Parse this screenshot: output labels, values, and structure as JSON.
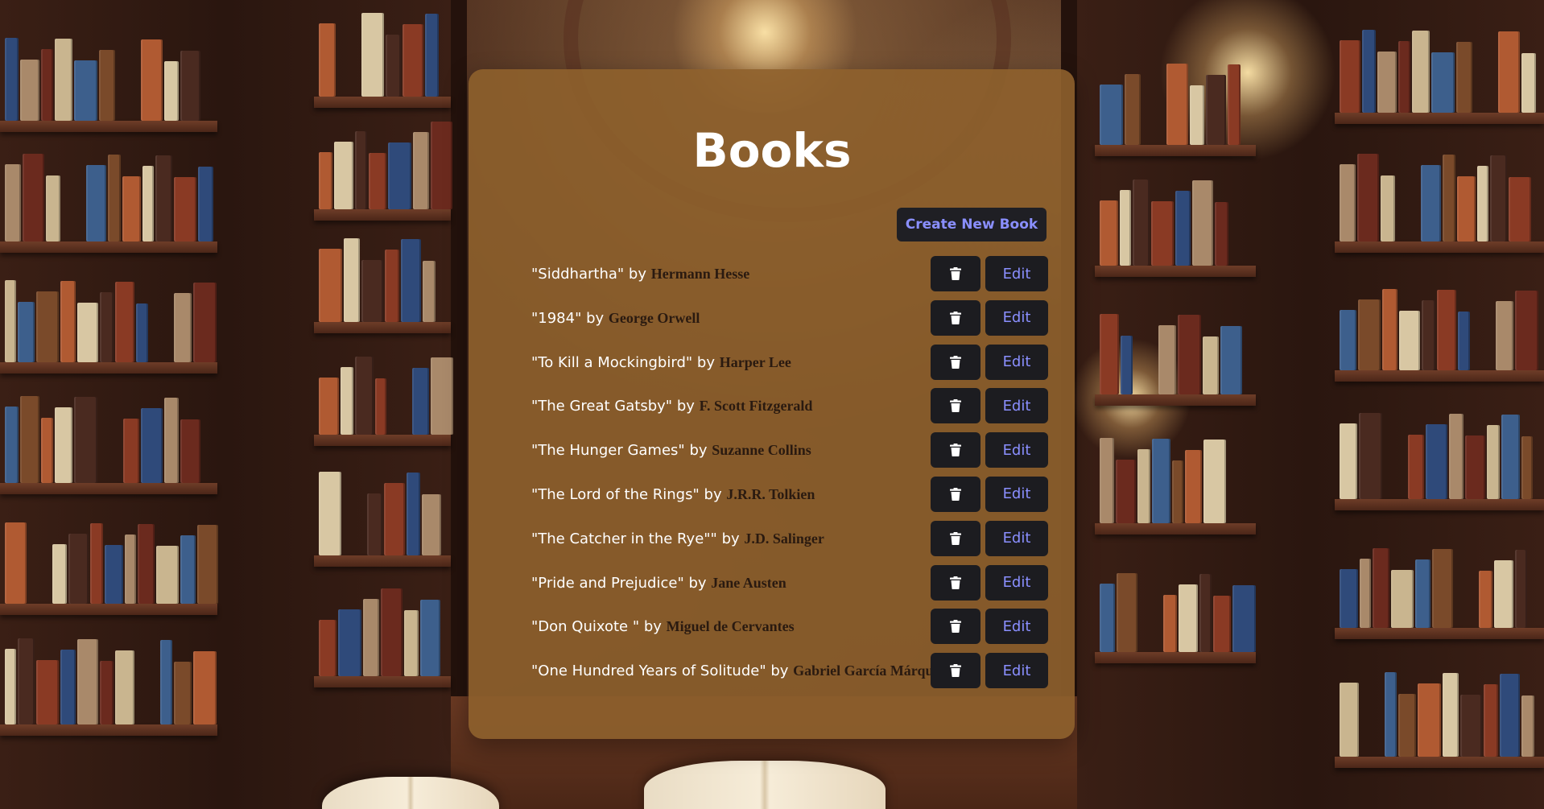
{
  "page": {
    "title": "Books",
    "create_button_label": "Create New Book",
    "edit_label": "Edit",
    "by_word": "by"
  },
  "icons": {
    "delete": "trash-icon"
  },
  "colors": {
    "panel": "#8e602c",
    "button_bg": "#1c1c20",
    "button_text": "#8a8fff",
    "author_text": "#2a1a10"
  },
  "books": [
    {
      "title": "\"Siddhartha\"",
      "author": "Hermann Hesse"
    },
    {
      "title": "\"1984\"",
      "author": "George Orwell"
    },
    {
      "title": "\"To Kill a Mockingbird\"",
      "author": "Harper Lee"
    },
    {
      "title": "\"The Great Gatsby\"",
      "author": "F. Scott Fitzgerald"
    },
    {
      "title": "\"The Hunger Games\"",
      "author": "Suzanne Collins"
    },
    {
      "title": "\"The Lord of the Rings\"",
      "author": "J.R.R. Tolkien"
    },
    {
      "title": "\"The Catcher in the Rye\"\"",
      "author": "J.D. Salinger"
    },
    {
      "title": "\"Pride and Prejudice\"",
      "author": "Jane Austen"
    },
    {
      "title": "\"Don Quixote \"",
      "author": "Miguel de Cervantes"
    },
    {
      "title": "\"One Hundred Years of Solitude\"",
      "author": "Gabriel García Márquez"
    }
  ]
}
